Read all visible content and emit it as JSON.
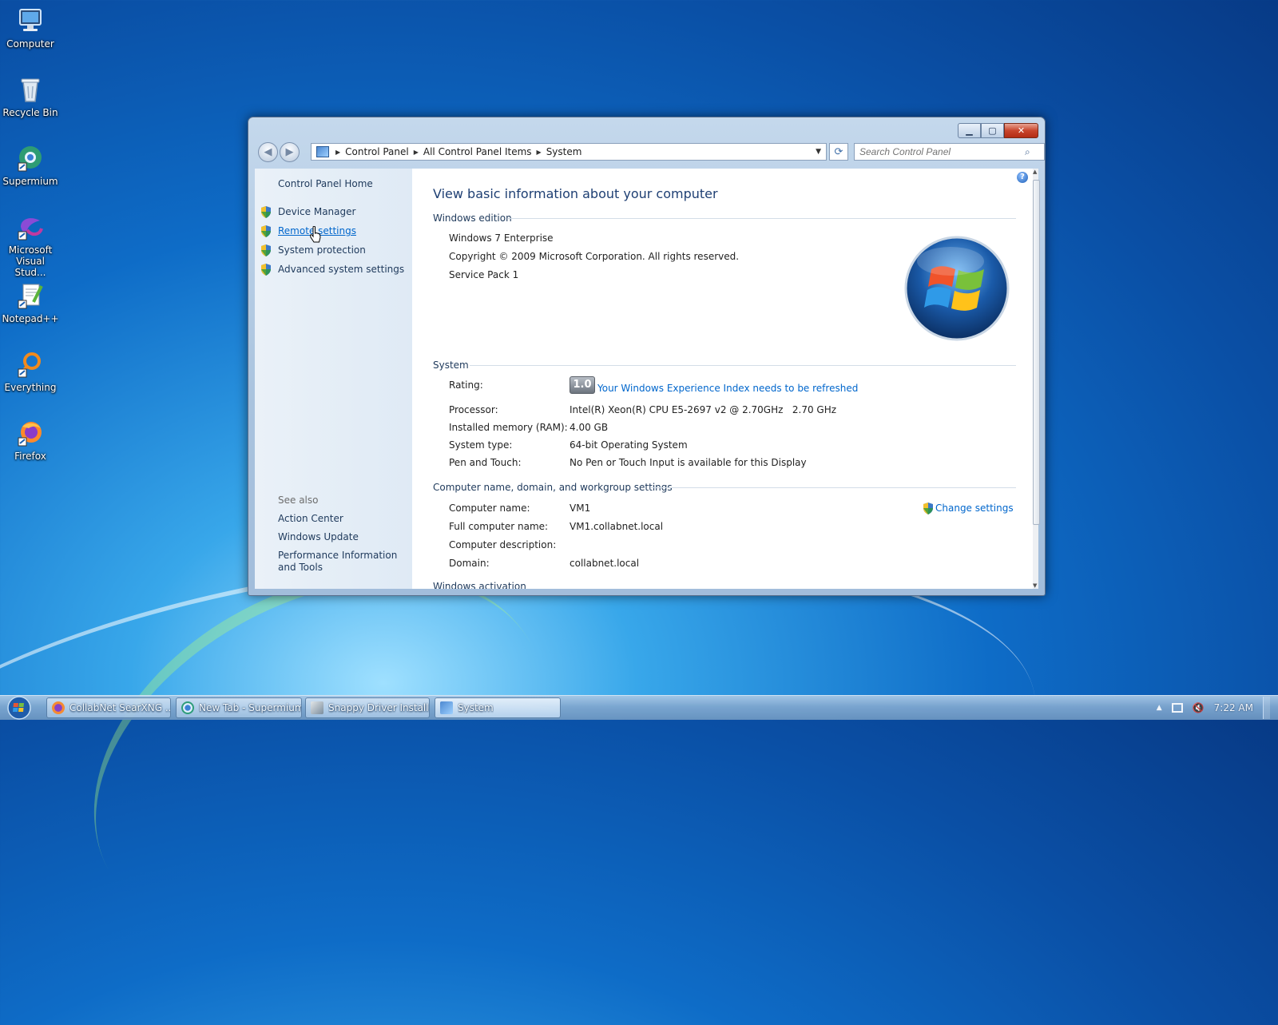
{
  "desktop": {
    "icons": [
      {
        "label": "Computer"
      },
      {
        "label": "Recycle Bin"
      },
      {
        "label": "Supermium"
      },
      {
        "label": "Microsoft Visual Stud..."
      },
      {
        "label": "Notepad++"
      },
      {
        "label": "Everything"
      },
      {
        "label": "Firefox"
      }
    ]
  },
  "window": {
    "breadcrumbs": [
      "Control Panel",
      "All Control Panel Items",
      "System"
    ],
    "search_placeholder": "Search Control Panel",
    "left_pane": {
      "home": "Control Panel Home",
      "links": [
        "Device Manager",
        "Remote settings",
        "System protection",
        "Advanced system settings"
      ],
      "see_also": "See also",
      "see_also_links": [
        "Action Center",
        "Windows Update",
        "Performance Information and Tools"
      ]
    },
    "content": {
      "title": "View basic information about your computer",
      "edition_section": "Windows edition",
      "edition": "Windows 7 Enterprise",
      "copyright": "Copyright © 2009 Microsoft Corporation.  All rights reserved.",
      "service_pack": "Service Pack 1",
      "system_section": "System",
      "rating_label": "Rating:",
      "rating_value": "1.0",
      "rating_link": "Your Windows Experience Index needs to be refreshed",
      "processor_label": "Processor:",
      "processor_value": "Intel(R) Xeon(R) CPU E5-2697 v2 @ 2.70GHz   2.70 GHz",
      "ram_label": "Installed memory (RAM):",
      "ram_value": "4.00 GB",
      "systype_label": "System type:",
      "systype_value": "64-bit Operating System",
      "pen_label": "Pen and Touch:",
      "pen_value": "No Pen or Touch Input is available for this Display",
      "name_section": "Computer name, domain, and workgroup settings",
      "change_settings": "Change settings",
      "computer_name_label": "Computer name:",
      "computer_name_value": "VM1",
      "full_name_label": "Full computer name:",
      "full_name_value": "VM1.collabnet.local",
      "description_label": "Computer description:",
      "domain_label": "Domain:",
      "domain_value": "collabnet.local",
      "activation_section": "Windows activation"
    }
  },
  "taskbar": {
    "buttons": [
      "CollabNet SearXNG ...",
      "New Tab - Supermium",
      "Snappy Driver Install...",
      "System"
    ],
    "clock": "7:22 AM"
  },
  "colors": {
    "link": "#0066cc",
    "heading": "#1e3f73",
    "desktop": "#0e6cc7"
  }
}
